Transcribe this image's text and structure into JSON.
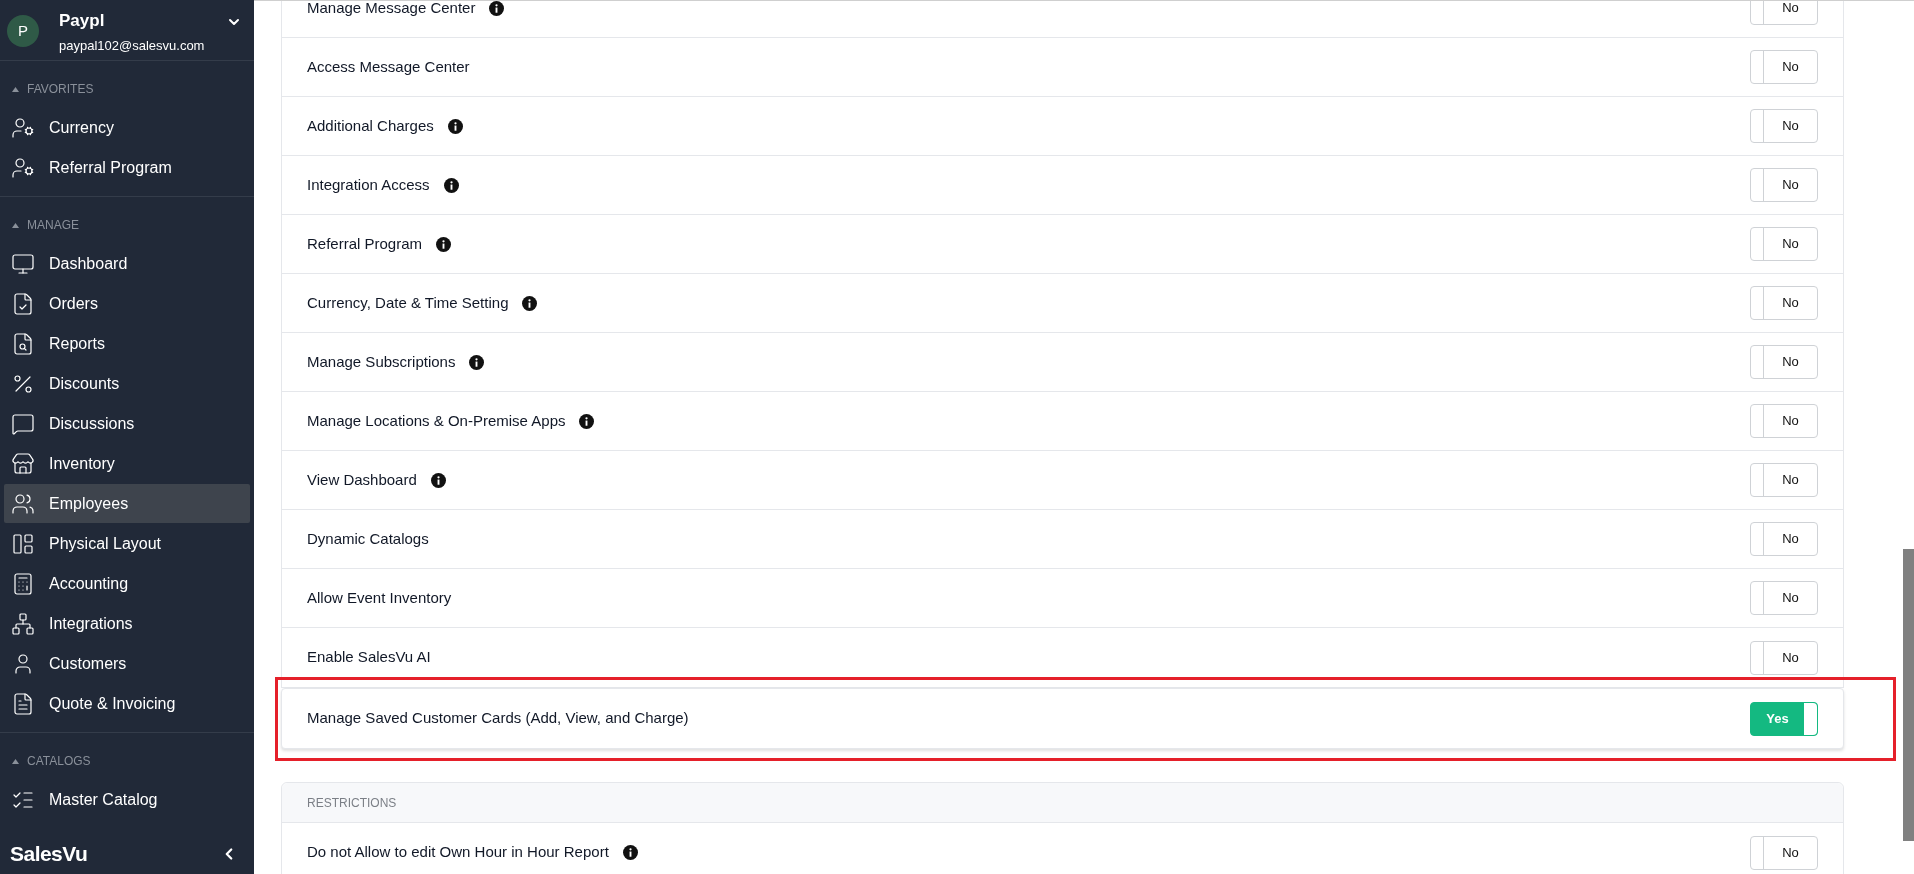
{
  "sidebar": {
    "account": {
      "initial": "P",
      "name": "Paypl",
      "email": "paypal102@salesvu.com"
    },
    "sections": [
      {
        "title": "FAVORITES",
        "expanded": true,
        "items": [
          {
            "label": "Currency",
            "selected": false
          },
          {
            "label": "Referral Program",
            "selected": false
          }
        ]
      },
      {
        "title": "MANAGE",
        "expanded": true,
        "items": [
          {
            "label": "Dashboard",
            "selected": false
          },
          {
            "label": "Orders",
            "selected": false
          },
          {
            "label": "Reports",
            "selected": false
          },
          {
            "label": "Discounts",
            "selected": false
          },
          {
            "label": "Discussions",
            "selected": false
          },
          {
            "label": "Inventory",
            "selected": false
          },
          {
            "label": "Employees",
            "selected": true
          },
          {
            "label": "Physical Layout",
            "selected": false
          },
          {
            "label": "Accounting",
            "selected": false
          },
          {
            "label": "Integrations",
            "selected": false
          },
          {
            "label": "Customers",
            "selected": false
          },
          {
            "label": "Quote & Invoicing",
            "selected": false
          }
        ]
      },
      {
        "title": "CATALOGS",
        "expanded": true,
        "items": [
          {
            "label": "Master Catalog",
            "selected": false
          }
        ]
      }
    ],
    "logo": "SalesVu"
  },
  "permissions": [
    {
      "label": "Manage Message Center",
      "info": true,
      "on": false,
      "value": "No"
    },
    {
      "label": "Access Message Center",
      "info": false,
      "on": false,
      "value": "No"
    },
    {
      "label": "Additional Charges",
      "info": true,
      "on": false,
      "value": "No"
    },
    {
      "label": "Integration Access",
      "info": true,
      "on": false,
      "value": "No"
    },
    {
      "label": "Referral Program",
      "info": true,
      "on": false,
      "value": "No"
    },
    {
      "label": "Currency, Date & Time Setting",
      "info": true,
      "on": false,
      "value": "No"
    },
    {
      "label": "Manage Subscriptions",
      "info": true,
      "on": false,
      "value": "No"
    },
    {
      "label": "Manage Locations & On-Premise Apps",
      "info": true,
      "on": false,
      "value": "No"
    },
    {
      "label": "View Dashboard",
      "info": true,
      "on": false,
      "value": "No"
    },
    {
      "label": "Dynamic Catalogs",
      "info": false,
      "on": false,
      "value": "No"
    },
    {
      "label": "Allow Event Inventory",
      "info": false,
      "on": false,
      "value": "No"
    },
    {
      "label": "Enable SalesVu AI",
      "info": false,
      "on": false,
      "value": "No"
    }
  ],
  "highlighted_permission": {
    "label": "Manage Saved Customer Cards (Add, View, and Charge)",
    "info": false,
    "on": true,
    "value": "Yes",
    "outlined": true
  },
  "restrictions": {
    "title": "RESTRICTIONS",
    "rows": [
      {
        "label": "Do not Allow to edit Own Hour in Hour Report",
        "info": true,
        "on": false,
        "value": "No"
      }
    ]
  }
}
